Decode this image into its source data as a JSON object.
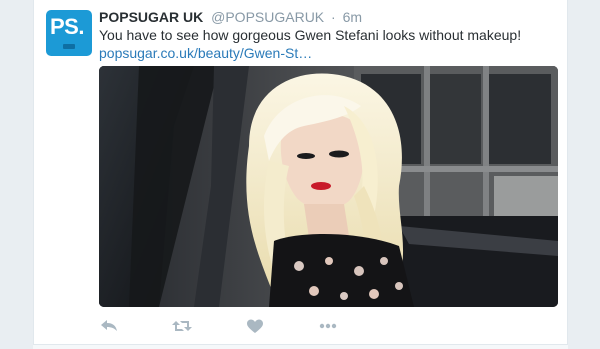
{
  "tweet": {
    "author_name": "POPSUGAR UK",
    "handle": "@POPSUGARUK",
    "separator": "·",
    "time": "6m",
    "text": "You have to see how gorgeous Gwen Stefani looks without makeup!",
    "link_text": "popsugar.co.uk/beauty/Gwen-St…",
    "avatar_text": "PS."
  },
  "actions": [
    {
      "icon": "reply-icon"
    },
    {
      "icon": "retweet-icon"
    },
    {
      "icon": "like-icon"
    },
    {
      "icon": "more-icon"
    }
  ],
  "colors": {
    "brand": "#1c9ad6",
    "link": "#2b7bb9",
    "muted": "#8899a6",
    "text": "#292f33",
    "action_icon": "#aab8c2"
  }
}
